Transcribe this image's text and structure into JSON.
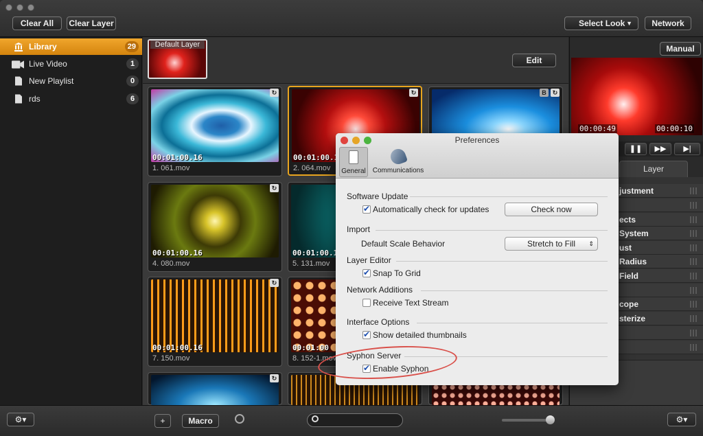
{
  "toolbar": {
    "clear_all": "Clear All",
    "clear_layer": "Clear Layer",
    "select_look": "Select Look",
    "network": "Network"
  },
  "sidebar": {
    "items": [
      {
        "label": "Library",
        "count": "29",
        "icon": "library-icon",
        "selected": true
      },
      {
        "label": "Live Video",
        "count": "1",
        "icon": "video-camera-icon",
        "selected": false
      },
      {
        "label": "New Playlist",
        "count": "0",
        "icon": "document-icon",
        "selected": false
      },
      {
        "label": "rds",
        "count": "6",
        "icon": "document-icon",
        "selected": false
      }
    ]
  },
  "layerbar": {
    "default_layer": "Default Layer",
    "edit": "Edit"
  },
  "clips": [
    {
      "duration": "00:01:00.16",
      "name": "1. 061.mov"
    },
    {
      "duration": "00:01:00.1",
      "name": "2. 064.mov"
    },
    {
      "duration": "",
      "name": ""
    },
    {
      "duration": "00:01:00.16",
      "name": "4. 080.mov"
    },
    {
      "duration": "00:01:00.1",
      "name": "5. 131.mov"
    },
    {
      "duration": "00:01:00.16",
      "name": "7. 150.mov"
    },
    {
      "duration": "00:01:00",
      "name": "8. 152-1.mov"
    }
  ],
  "right_panel": {
    "manual": "Manual",
    "time_elapsed": "00:00:49",
    "time_remaining": "00:00:10",
    "tab_layer": "Layer",
    "rows": [
      "justment",
      "",
      "ects",
      "System",
      "ust",
      "Radius",
      "Field",
      "",
      "cope",
      "sterize",
      "",
      ""
    ]
  },
  "bottombar": {
    "macro": "Macro",
    "plus": "+"
  },
  "preferences": {
    "title": "Preferences",
    "tab_general": "General",
    "tab_communications": "Communications",
    "software_update": "Software Update",
    "auto_check": "Automatically check for updates",
    "check_now": "Check now",
    "import": "Import",
    "default_scale": "Default Scale Behavior",
    "scale_value": "Stretch to Fill",
    "layer_editor": "Layer Editor",
    "snap_to_grid": "Snap To Grid",
    "network_additions": "Network Additions",
    "receive_text": "Receive Text Stream",
    "interface_options": "Interface Options",
    "detailed_thumbs": "Show detailed thumbnails",
    "syphon_server": "Syphon Server",
    "enable_syphon": "Enable Syphon"
  },
  "colors": {
    "accent_orange": "#e8a51f",
    "annotation_red": "#d9504a"
  }
}
